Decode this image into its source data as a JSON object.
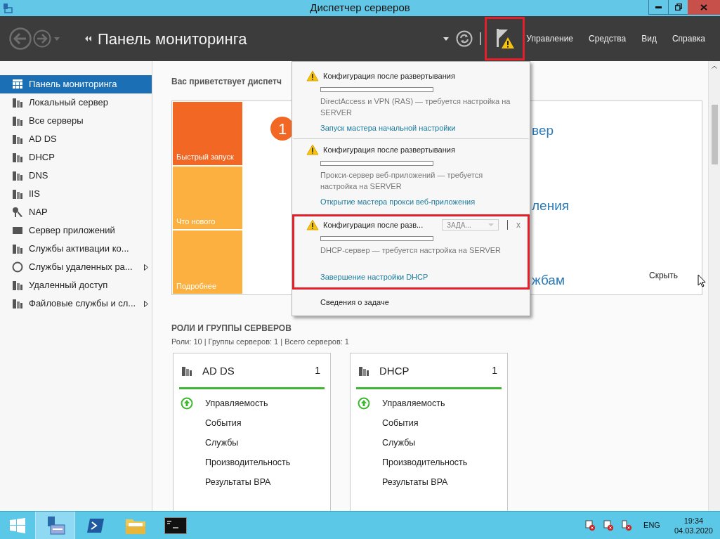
{
  "window": {
    "title": "Диспетчер серверов"
  },
  "header": {
    "title": "Панель мониторинга",
    "flag_highlighted": true,
    "menu": [
      "Управление",
      "Средства",
      "Вид",
      "Справка"
    ]
  },
  "sidebar": {
    "items": [
      {
        "label": "Панель мониторинга",
        "selected": true,
        "submenu": false
      },
      {
        "label": "Локальный сервер",
        "selected": false,
        "submenu": false
      },
      {
        "label": "Все серверы",
        "selected": false,
        "submenu": false
      },
      {
        "label": "AD DS",
        "selected": false,
        "submenu": false
      },
      {
        "label": "DHCP",
        "selected": false,
        "submenu": false
      },
      {
        "label": "DNS",
        "selected": false,
        "submenu": false
      },
      {
        "label": "IIS",
        "selected": false,
        "submenu": false
      },
      {
        "label": "NAP",
        "selected": false,
        "submenu": false
      },
      {
        "label": "Сервер приложений",
        "selected": false,
        "submenu": false
      },
      {
        "label": "Службы активации ко...",
        "selected": false,
        "submenu": false
      },
      {
        "label": "Службы удаленных ра...",
        "selected": false,
        "submenu": true
      },
      {
        "label": "Удаленный доступ",
        "selected": false,
        "submenu": false
      },
      {
        "label": "Файловые службы и сл...",
        "selected": false,
        "submenu": true
      }
    ]
  },
  "welcome": {
    "heading": "Вас приветствует диспетч",
    "step": "1",
    "tiles": [
      {
        "label": "Быстрый запуск",
        "color": "#f26724"
      },
      {
        "label": "Что нового",
        "color": "#fbb040"
      },
      {
        "label": "Подробнее",
        "color": "#fbb040"
      }
    ],
    "fragments": [
      "вер",
      "ления",
      "жбам"
    ],
    "hide": "Скрыть"
  },
  "notifications": {
    "items": [
      {
        "title": "Конфигурация после развертывания",
        "level": 0,
        "description": "DirectAccess и VPN (RAS) — требуется настройка на SERVER",
        "link": "Запуск мастера начальной настройки",
        "highlighted": false
      },
      {
        "title": "Конфигурация после развертывания",
        "level": 0,
        "description": "Прокси-сервер веб-приложений — требуется настройка на SERVER",
        "link": "Открытие мастера прокси веб-приложения",
        "highlighted": false
      },
      {
        "title": "Конфигурация после разв...",
        "level": 0,
        "description": "DHCP-сервер — требуется настройка на SERVER",
        "link": "Завершение настройки DHCP",
        "highlighted": true,
        "task_button": "ЗАДА...",
        "close": "x"
      }
    ],
    "footer": "Сведения о задаче"
  },
  "roles": {
    "heading": "РОЛИ И ГРУППЫ СЕРВЕРОВ",
    "summary": "Роли: 10 | Группы серверов: 1 | Всего серверов: 1",
    "cards": [
      {
        "name": "AD DS",
        "count": "1",
        "rows": [
          {
            "label": "Управляемость",
            "kind": "status"
          },
          {
            "label": "События",
            "kind": "plain"
          },
          {
            "label": "Службы",
            "kind": "plain"
          },
          {
            "label": "Производительность",
            "kind": "plain"
          },
          {
            "label": "Результаты BPA",
            "kind": "plain"
          }
        ]
      },
      {
        "name": "DHCP",
        "count": "1",
        "rows": [
          {
            "label": "Управляемость",
            "kind": "status"
          },
          {
            "label": "События",
            "kind": "plain"
          },
          {
            "label": "Службы",
            "kind": "plain"
          },
          {
            "label": "Производительность",
            "kind": "plain"
          },
          {
            "label": "Результаты BPA",
            "kind": "plain"
          }
        ]
      }
    ]
  },
  "taskbar": {
    "apps": [
      {
        "selected": false
      },
      {
        "selected": true
      },
      {
        "selected": false
      },
      {
        "selected": false
      },
      {
        "selected": false
      }
    ],
    "language": "ENG",
    "time": "19:34",
    "date": "04.03.2020"
  }
}
